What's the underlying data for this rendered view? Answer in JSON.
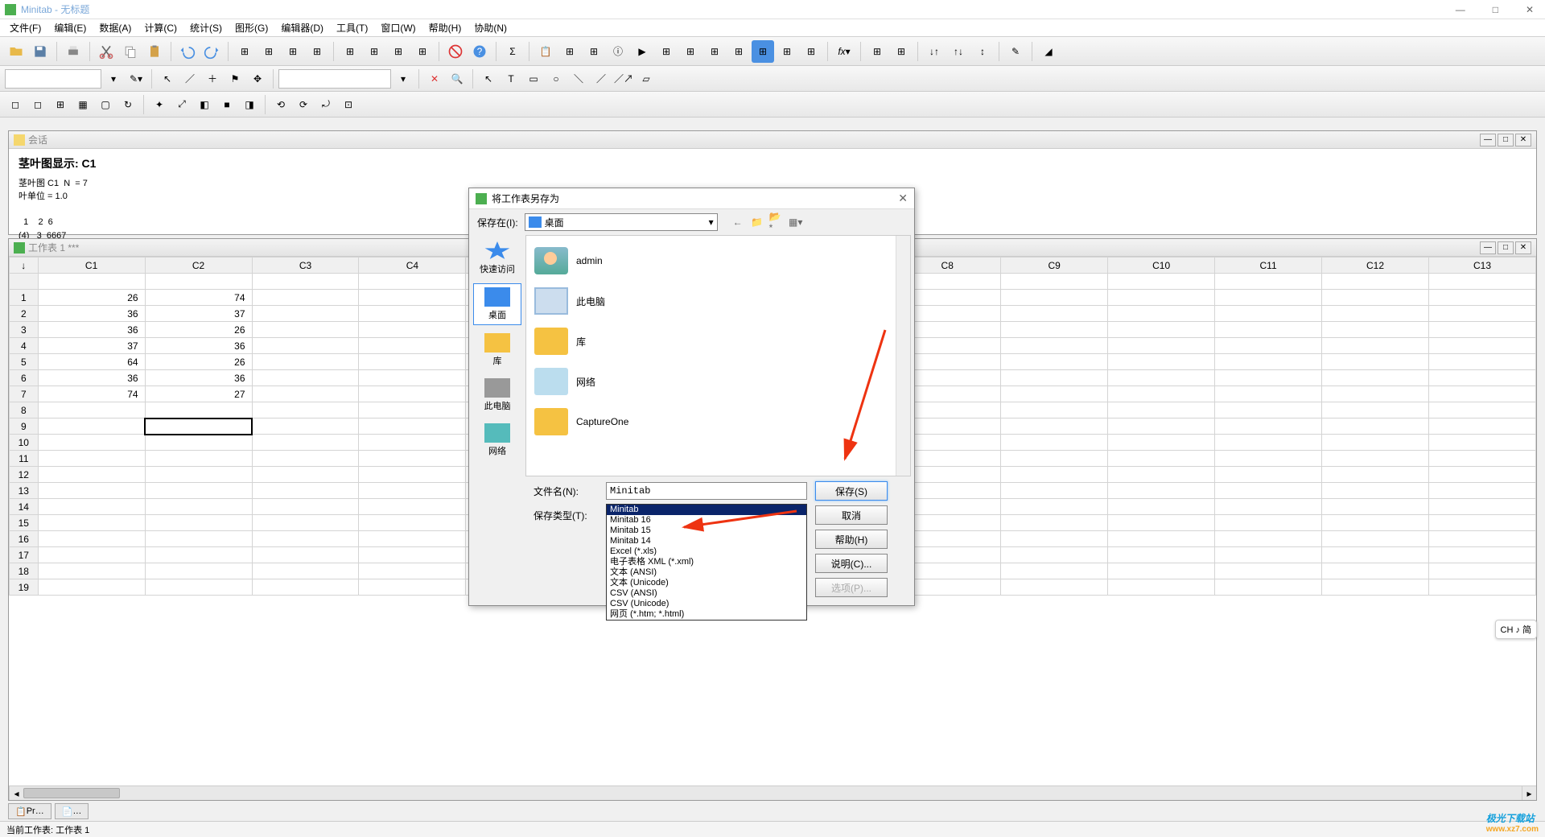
{
  "app": {
    "title": "Minitab - 无标题"
  },
  "window_controls": {
    "min": "—",
    "max": "□",
    "close": "✕"
  },
  "menu": [
    "文件(F)",
    "编辑(E)",
    "数据(A)",
    "计算(C)",
    "统计(S)",
    "图形(G)",
    "编辑器(D)",
    "工具(T)",
    "窗口(W)",
    "帮助(H)",
    "协助(N)"
  ],
  "session": {
    "title": "会话",
    "heading": "茎叶图显示: C1",
    "lines": [
      "茎叶图 C1  N  = 7",
      "叶单位 = 1.0",
      "",
      "  1    2  6",
      "(4)   3  6667"
    ]
  },
  "worksheet": {
    "title": "工作表 1 ***",
    "columns": [
      "C1",
      "C2",
      "C3",
      "C4",
      "",
      "",
      "",
      "",
      "C8",
      "C9",
      "C10",
      "C11",
      "C12",
      "C13"
    ],
    "rows": [
      {
        "n": "1",
        "c1": "26",
        "c2": "74"
      },
      {
        "n": "2",
        "c1": "36",
        "c2": "37"
      },
      {
        "n": "3",
        "c1": "36",
        "c2": "26"
      },
      {
        "n": "4",
        "c1": "37",
        "c2": "36"
      },
      {
        "n": "5",
        "c1": "64",
        "c2": "26"
      },
      {
        "n": "6",
        "c1": "36",
        "c2": "36"
      },
      {
        "n": "7",
        "c1": "74",
        "c2": "27"
      },
      {
        "n": "8",
        "c1": "",
        "c2": ""
      },
      {
        "n": "9",
        "c1": "",
        "c2": ""
      },
      {
        "n": "10",
        "c1": "",
        "c2": ""
      },
      {
        "n": "11",
        "c1": "",
        "c2": ""
      },
      {
        "n": "12",
        "c1": "",
        "c2": ""
      },
      {
        "n": "13",
        "c1": "",
        "c2": ""
      },
      {
        "n": "14",
        "c1": "",
        "c2": ""
      },
      {
        "n": "15",
        "c1": "",
        "c2": ""
      },
      {
        "n": "16",
        "c1": "",
        "c2": ""
      },
      {
        "n": "17",
        "c1": "",
        "c2": ""
      },
      {
        "n": "18",
        "c1": "",
        "c2": ""
      },
      {
        "n": "19",
        "c1": "",
        "c2": ""
      }
    ],
    "arrow_head": "↓"
  },
  "bottom_tabs": [
    "Pr…",
    "…"
  ],
  "status": "当前工作表: 工作表 1",
  "dialog": {
    "title": "将工作表另存为",
    "save_in_label": "保存在(I):",
    "location": "桌面",
    "sidebar": [
      {
        "label": "快速访问",
        "icon": "star"
      },
      {
        "label": "桌面",
        "icon": "desktop",
        "active": true
      },
      {
        "label": "库",
        "icon": "lib"
      },
      {
        "label": "此电脑",
        "icon": "pc"
      },
      {
        "label": "网络",
        "icon": "net"
      }
    ],
    "files": [
      {
        "label": "admin",
        "icon": "user"
      },
      {
        "label": "此电脑",
        "icon": "pc"
      },
      {
        "label": "库",
        "icon": "folder"
      },
      {
        "label": "网络",
        "icon": "net"
      },
      {
        "label": "CaptureOne",
        "icon": "folder"
      }
    ],
    "filename_label": "文件名(N):",
    "filename_value": "Minitab",
    "filetype_label": "保存类型(T):",
    "filetype_value": "Minitab",
    "filetype_options": [
      "Minitab",
      "Minitab 16",
      "Minitab 15",
      "Minitab 14",
      "Excel (*.xls)",
      "电子表格 XML (*.xml)",
      "文本 (ANSI)",
      "文本 (Unicode)",
      "CSV (ANSI)",
      "CSV (Unicode)",
      "网页 (*.htm; *.html)"
    ],
    "buttons": {
      "save": "保存(S)",
      "cancel": "取消",
      "help": "帮助(H)",
      "desc": "说明(C)...",
      "opts": "选项(P)..."
    }
  },
  "ime": "CH ♪ 简",
  "watermark": {
    "brand": "极光下载站",
    "url": "www.xz7.com"
  }
}
